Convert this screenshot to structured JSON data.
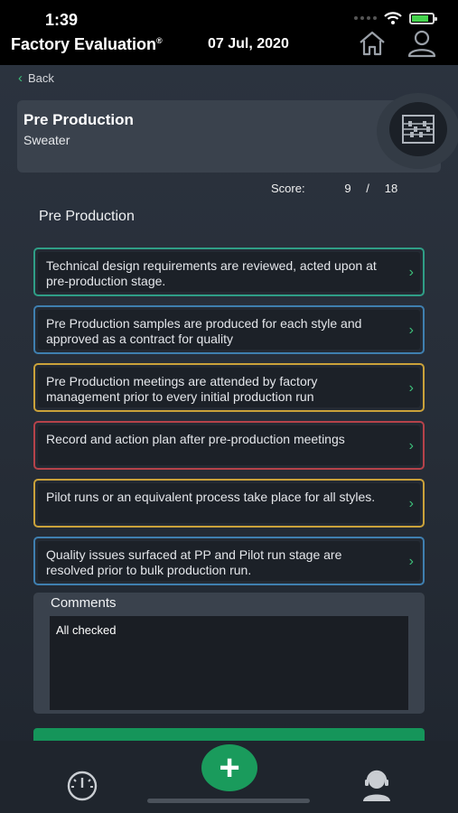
{
  "status_bar": {
    "time": "1:39"
  },
  "header": {
    "app_title": "Factory Evaluation",
    "registered_mark": "®",
    "date": "07 Jul, 2020"
  },
  "nav": {
    "back_label": "Back"
  },
  "section_card": {
    "title": "Pre Production",
    "subtitle": "Sweater"
  },
  "score": {
    "label": "Score:",
    "value": "9",
    "separator": "/",
    "total": "18"
  },
  "section_heading": "Pre Production",
  "questions": [
    {
      "text": "Technical design requirements are reviewed, acted upon at pre-production stage.",
      "border_color": "#2f9e86"
    },
    {
      "text": "Pre Production samples are produced for each style and approved as a contract for quality",
      "border_color": "#3f7fb0"
    },
    {
      "text": "Pre Production meetings are attended by factory management prior to every initial production run",
      "border_color": "#caa23a"
    },
    {
      "text": "Record and action plan after pre-production meetings",
      "border_color": "#b5424a"
    },
    {
      "text": "Pilot runs or an equivalent process take place for all styles.",
      "border_color": "#caa23a"
    },
    {
      "text": "Quality issues surfaced at PP and Pilot run stage are resolved prior to bulk production run.",
      "border_color": "#3f7fb0"
    }
  ],
  "comments": {
    "label": "Comments",
    "value": "All checked"
  },
  "colors": {
    "accent_green": "#1a9b5c",
    "chevron": "#3dbf7a",
    "background": "#2a313c"
  },
  "icons": [
    "home-icon",
    "user-icon",
    "abacus-icon",
    "gauge-icon",
    "support-agent-icon",
    "plus-icon",
    "chevron-left-icon",
    "chevron-right-icon"
  ]
}
